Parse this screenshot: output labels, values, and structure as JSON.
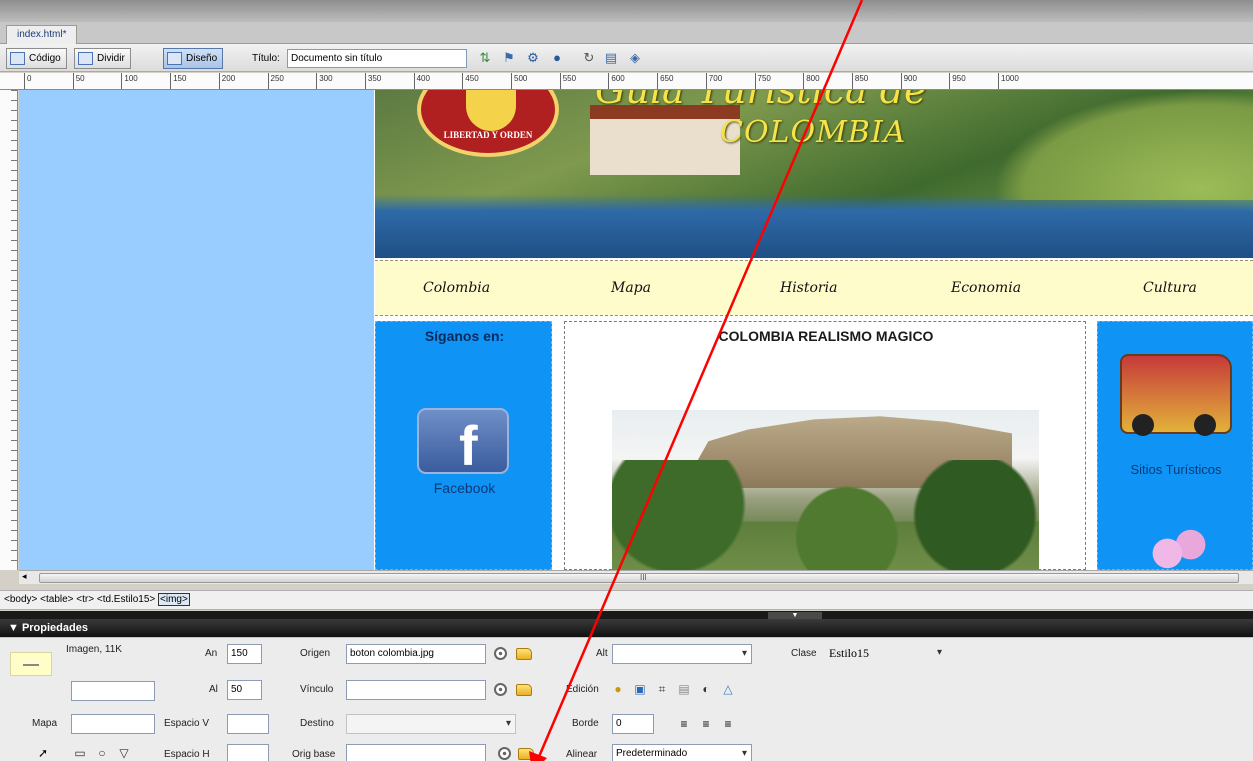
{
  "document_tab": "index.html*",
  "toolbar": {
    "code_label": "Código",
    "split_label": "Dividir",
    "design_label": "Diseño",
    "title_label": "Título:",
    "title_value": "Documento sin título"
  },
  "ruler_ticks": [
    "0",
    "50",
    "100",
    "150",
    "200",
    "250",
    "300",
    "350",
    "400",
    "450",
    "500",
    "550",
    "600",
    "650",
    "700",
    "750",
    "800",
    "850",
    "900",
    "950",
    "1000"
  ],
  "page": {
    "banner_title": "COLOMBIA",
    "banner_title_partial": "Guia Turistica de",
    "emblem_text": "LIBERTAD Y ORDEN",
    "nav_items": [
      "Colombia",
      "Mapa",
      "Historia",
      "Economia",
      "Cultura"
    ],
    "follow_us": "Síganos en:",
    "facebook_label": "Facebook",
    "center_title": "COLOMBIA REALISMO MAGICO",
    "sitios_label": "Sitios Turísticos"
  },
  "scrollbar": {
    "grip": "III"
  },
  "tag_selector": {
    "path": "<body> <table> <tr> <td.Estilo15> ",
    "selected": "<img>"
  },
  "properties": {
    "header": "▼ Propiedades",
    "image_info": "Imagen, 11K",
    "an_label": "An",
    "an_value": "150",
    "al_label": "Al",
    "al_value": "50",
    "origen_label": "Origen",
    "origen_value": "boton colombia.jpg",
    "vinculo_label": "Vínculo",
    "vinculo_value": "",
    "destino_label": "Destino",
    "origbase_label": "Orig base",
    "alt_label": "Alt",
    "edicion_label": "Edición",
    "borde_label": "Borde",
    "borde_value": "0",
    "alinear_label": "Alinear",
    "alinear_value": "Predeterminado",
    "clase_label": "Clase",
    "clase_value": "Estilo15",
    "mapa_label": "Mapa",
    "espacio_v_label": "Espacio V",
    "espacio_h_label": "Espacio H"
  },
  "colors": {
    "canvas_left": "#99ccff",
    "side_panels": "#0f93f5",
    "navbar": "#fffccc",
    "annotation_arrow": "#ff0000"
  }
}
